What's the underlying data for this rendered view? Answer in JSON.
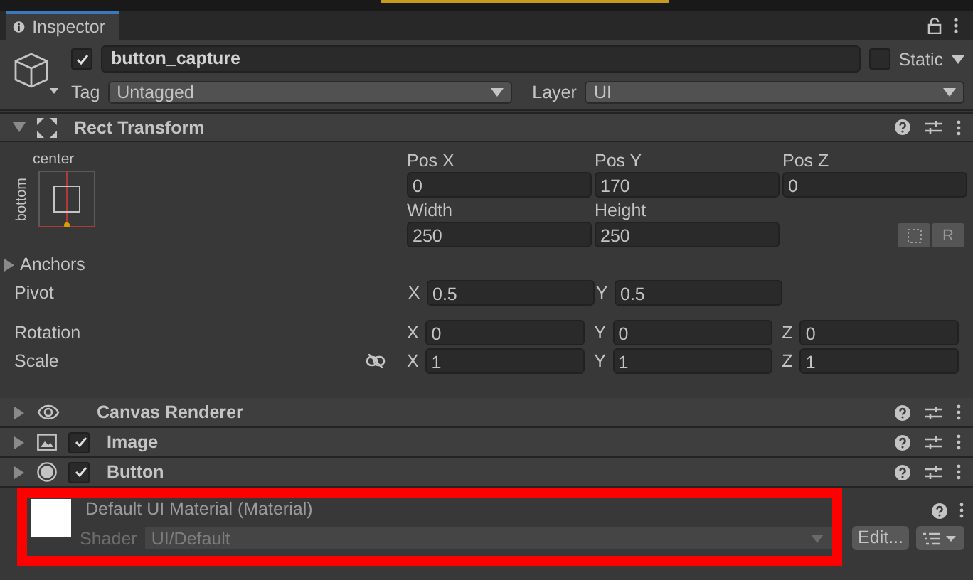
{
  "window": {
    "tab": {
      "label": "Inspector",
      "selected": true
    }
  },
  "object": {
    "active": true,
    "name": "button_capture",
    "static": false,
    "static_label": "Static",
    "tag_label": "Tag",
    "tag": "Untagged",
    "layer_label": "Layer",
    "layer": "UI"
  },
  "rect_transform": {
    "title": "Rect Transform",
    "expanded": true,
    "anchor_h": "center",
    "anchor_v": "bottom",
    "fields": [
      {
        "label": "Pos X",
        "value": "0"
      },
      {
        "label": "Pos Y",
        "value": "170"
      },
      {
        "label": "Pos Z",
        "value": "0"
      },
      {
        "label": "Width",
        "value": "250"
      },
      {
        "label": "Height",
        "value": "250"
      }
    ],
    "raw_button": "R",
    "anchors": {
      "label": "Anchors",
      "expanded": false
    },
    "rows": [
      {
        "label": "Pivot",
        "linked": false,
        "axes": [
          {
            "axis": "X",
            "value": "0.5"
          },
          {
            "axis": "Y",
            "value": "0.5"
          }
        ]
      },
      {
        "label": "Rotation",
        "linked": false,
        "axes": [
          {
            "axis": "X",
            "value": "0"
          },
          {
            "axis": "Y",
            "value": "0"
          },
          {
            "axis": "Z",
            "value": "0"
          }
        ]
      },
      {
        "label": "Scale",
        "linked": true,
        "axes": [
          {
            "axis": "X",
            "value": "1"
          },
          {
            "axis": "Y",
            "value": "1"
          },
          {
            "axis": "Z",
            "value": "1"
          }
        ]
      }
    ]
  },
  "components": [
    {
      "title": "Canvas Renderer",
      "kind": "eye",
      "expanded": false
    },
    {
      "title": "Image",
      "kind": "image",
      "expanded": false,
      "enabled": true
    },
    {
      "title": "Button",
      "kind": "button",
      "expanded": false,
      "enabled": true
    }
  ],
  "material": {
    "name": "Default UI Material (Material)",
    "shader_label": "Shader",
    "shader": "UI/Default",
    "edit": "Edit...",
    "highlighted": true
  }
}
